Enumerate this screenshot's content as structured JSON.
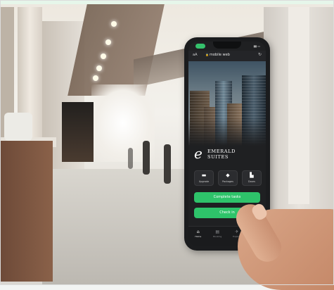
{
  "browser": {
    "aa_label": "aA",
    "url": "mobile web",
    "status_time": ""
  },
  "brand": {
    "logo_letter": "e",
    "name_line1": "EMERALD",
    "name_line2": "SUITES"
  },
  "quick_actions": [
    {
      "icon": "bed-icon",
      "glyph": "▬",
      "label": "Upgrade"
    },
    {
      "icon": "packages-icon",
      "glyph": "◆",
      "label": "Packages"
    },
    {
      "icon": "doors-icon",
      "glyph": "▙",
      "label": "Doors"
    }
  ],
  "actions": {
    "complete_tasks": "Complete tasks",
    "check_in": "Check in"
  },
  "tabs": [
    {
      "icon": "home-icon",
      "glyph": "⌂",
      "label": "Home",
      "active": true
    },
    {
      "icon": "booking-icon",
      "glyph": "▤",
      "label": "Booking",
      "active": false
    },
    {
      "icon": "explore-icon",
      "glyph": "✈",
      "label": "Explore",
      "active": false
    },
    {
      "icon": "profile-icon",
      "glyph": "◉",
      "label": "Profile",
      "active": false
    }
  ],
  "colors": {
    "accent_green": "#2ec36a",
    "app_background": "#1f2022"
  }
}
